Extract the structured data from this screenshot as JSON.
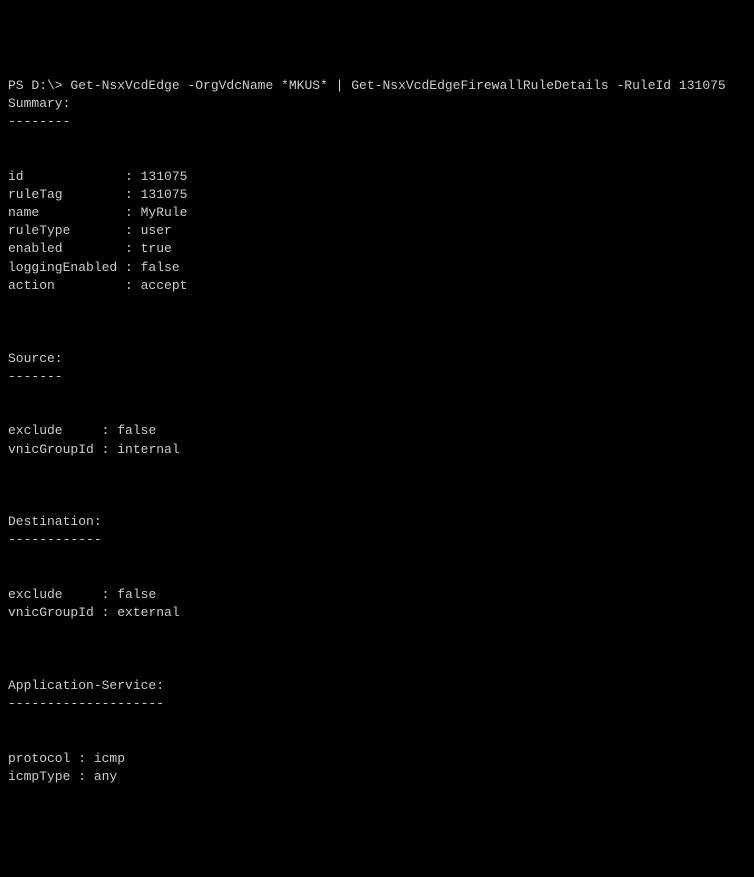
{
  "prompt": "PS D:\\> Get-NsxVcdEdge -OrgVdcName *MKUS* | Get-NsxVcdEdgeFirewallRuleDetails -RuleId 131075",
  "sections": {
    "summary": {
      "header": "Summary:",
      "underline": "--------",
      "fields": {
        "id": {
          "label": "id            ",
          "value": "131075"
        },
        "ruleTag": {
          "label": "ruleTag       ",
          "value": "131075"
        },
        "name": {
          "label": "name          ",
          "value": "MyRule"
        },
        "ruleType": {
          "label": "ruleType      ",
          "value": "user"
        },
        "enabled": {
          "label": "enabled       ",
          "value": "true"
        },
        "loggingEnabled": {
          "label": "loggingEnabled",
          "value": "false"
        },
        "action": {
          "label": "action        ",
          "value": "accept"
        }
      }
    },
    "source": {
      "header": "Source:",
      "underline": "-------",
      "fields": {
        "exclude": {
          "label": "exclude    ",
          "value": "false"
        },
        "vnicGroupId": {
          "label": "vnicGroupId",
          "value": "internal"
        }
      }
    },
    "destination": {
      "header": "Destination:",
      "underline": "------------",
      "fields": {
        "exclude": {
          "label": "exclude    ",
          "value": "false"
        },
        "vnicGroupId": {
          "label": "vnicGroupId",
          "value": "external"
        }
      }
    },
    "applicationService": {
      "header": "Application-Service:",
      "underline": "--------------------",
      "fields": {
        "protocol": {
          "label": "protocol",
          "value": "icmp"
        },
        "icmpType": {
          "label": "icmpType",
          "value": "any"
        }
      }
    }
  },
  "separator": " : "
}
